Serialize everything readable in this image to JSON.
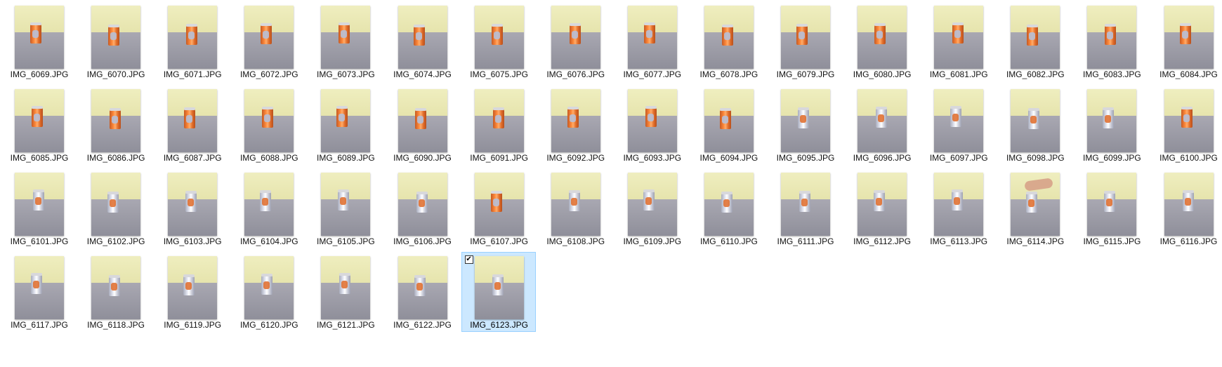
{
  "files": [
    {
      "name": "IMG_6069.JPG",
      "can": "orange"
    },
    {
      "name": "IMG_6070.JPG",
      "can": "orange"
    },
    {
      "name": "IMG_6071.JPG",
      "can": "orange"
    },
    {
      "name": "IMG_6072.JPG",
      "can": "orange"
    },
    {
      "name": "IMG_6073.JPG",
      "can": "orange"
    },
    {
      "name": "IMG_6074.JPG",
      "can": "orange"
    },
    {
      "name": "IMG_6075.JPG",
      "can": "orange"
    },
    {
      "name": "IMG_6076.JPG",
      "can": "orange"
    },
    {
      "name": "IMG_6077.JPG",
      "can": "orange"
    },
    {
      "name": "IMG_6078.JPG",
      "can": "orange"
    },
    {
      "name": "IMG_6079.JPG",
      "can": "orange"
    },
    {
      "name": "IMG_6080.JPG",
      "can": "orange"
    },
    {
      "name": "IMG_6081.JPG",
      "can": "orange"
    },
    {
      "name": "IMG_6082.JPG",
      "can": "orange"
    },
    {
      "name": "IMG_6083.JPG",
      "can": "orange"
    },
    {
      "name": "IMG_6084.JPG",
      "can": "orange"
    },
    {
      "name": "IMG_6085.JPG",
      "can": "orange"
    },
    {
      "name": "IMG_6086.JPG",
      "can": "orange"
    },
    {
      "name": "IMG_6087.JPG",
      "can": "orange"
    },
    {
      "name": "IMG_6088.JPG",
      "can": "orange"
    },
    {
      "name": "IMG_6089.JPG",
      "can": "orange"
    },
    {
      "name": "IMG_6090.JPG",
      "can": "orange"
    },
    {
      "name": "IMG_6091.JPG",
      "can": "orange"
    },
    {
      "name": "IMG_6092.JPG",
      "can": "orange"
    },
    {
      "name": "IMG_6093.JPG",
      "can": "orange"
    },
    {
      "name": "IMG_6094.JPG",
      "can": "orange"
    },
    {
      "name": "IMG_6095.JPG",
      "can": "silver"
    },
    {
      "name": "IMG_6096.JPG",
      "can": "silver"
    },
    {
      "name": "IMG_6097.JPG",
      "can": "silver"
    },
    {
      "name": "IMG_6098.JPG",
      "can": "silver"
    },
    {
      "name": "IMG_6099.JPG",
      "can": "silver"
    },
    {
      "name": "IMG_6100.JPG",
      "can": "orange"
    },
    {
      "name": "IMG_6101.JPG",
      "can": "silver"
    },
    {
      "name": "IMG_6102.JPG",
      "can": "silver"
    },
    {
      "name": "IMG_6103.JPG",
      "can": "silver"
    },
    {
      "name": "IMG_6104.JPG",
      "can": "silver"
    },
    {
      "name": "IMG_6105.JPG",
      "can": "silver"
    },
    {
      "name": "IMG_6106.JPG",
      "can": "silver"
    },
    {
      "name": "IMG_6107.JPG",
      "can": "orange"
    },
    {
      "name": "IMG_6108.JPG",
      "can": "silver"
    },
    {
      "name": "IMG_6109.JPG",
      "can": "silver"
    },
    {
      "name": "IMG_6110.JPG",
      "can": "silver"
    },
    {
      "name": "IMG_6111.JPG",
      "can": "silver"
    },
    {
      "name": "IMG_6112.JPG",
      "can": "silver"
    },
    {
      "name": "IMG_6113.JPG",
      "can": "silver"
    },
    {
      "name": "IMG_6114.JPG",
      "can": "silver",
      "hand": true
    },
    {
      "name": "IMG_6115.JPG",
      "can": "silver"
    },
    {
      "name": "IMG_6116.JPG",
      "can": "silver"
    },
    {
      "name": "IMG_6117.JPG",
      "can": "silver"
    },
    {
      "name": "IMG_6118.JPG",
      "can": "silver"
    },
    {
      "name": "IMG_6119.JPG",
      "can": "silver"
    },
    {
      "name": "IMG_6120.JPG",
      "can": "silver"
    },
    {
      "name": "IMG_6121.JPG",
      "can": "silver"
    },
    {
      "name": "IMG_6122.JPG",
      "can": "silver"
    },
    {
      "name": "IMG_6123.JPG",
      "can": "silver",
      "selected": true
    }
  ],
  "selection": {
    "checkbox_icon": "checkbox-checked-icon",
    "checkbox_glyph": "✔"
  }
}
